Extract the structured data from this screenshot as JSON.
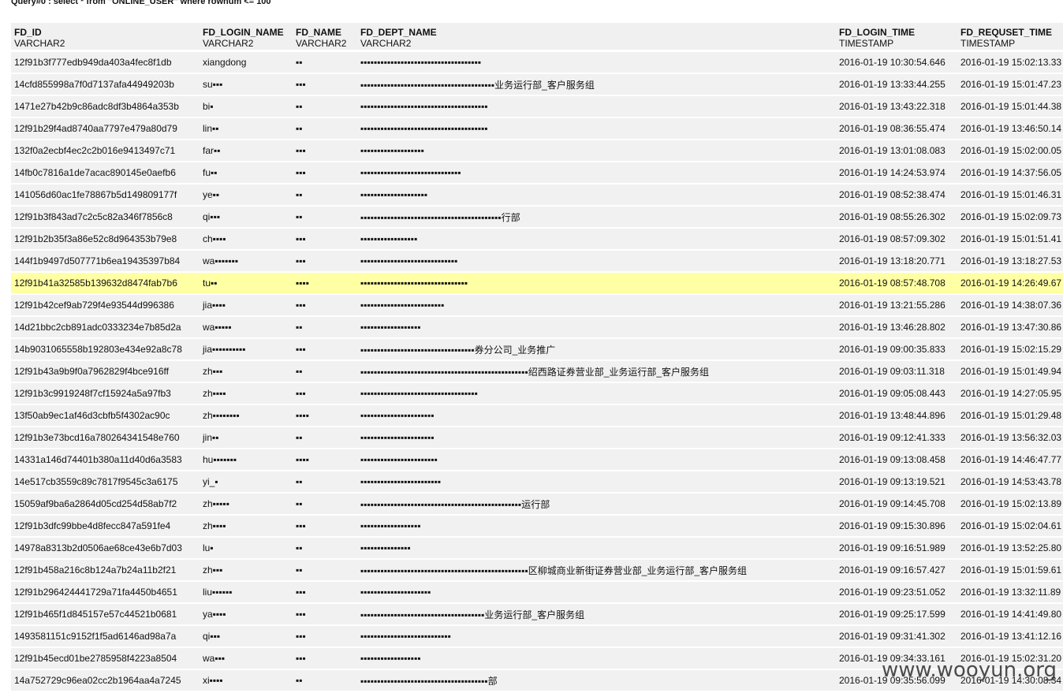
{
  "query": {
    "title": "Query#0 : select * from \"ONLINE_USER\" where rownum <= 100"
  },
  "columns": [
    {
      "name": "FD_ID",
      "type": "VARCHAR2"
    },
    {
      "name": "FD_LOGIN_NAME",
      "type": "VARCHAR2"
    },
    {
      "name": "FD_NAME",
      "type": "VARCHAR2"
    },
    {
      "name": "FD_DEPT_NAME",
      "type": "VARCHAR2"
    },
    {
      "name": "FD_LOGIN_TIME",
      "type": "TIMESTAMP"
    },
    {
      "name": "FD_REQUSET_TIME",
      "type": "TIMESTAMP"
    }
  ],
  "rows": [
    {
      "id": "12f91b3f777edb949da403a4fec8f1db",
      "login": "xiangdong",
      "name": "▪▪",
      "dept": "▪▪▪▪▪▪▪▪▪▪▪▪▪▪▪▪▪▪▪▪▪▪▪▪▪▪▪▪▪▪▪▪▪▪▪▪",
      "login_time": "2016-01-19 10:30:54.646",
      "req_time": "2016-01-19 15:02:13.33"
    },
    {
      "id": "14cfd855998a7f0d7137afa44949203b",
      "login": "su▪▪▪",
      "name": "▪▪▪",
      "dept": "▪▪▪▪▪▪▪▪▪▪▪▪▪▪▪▪▪▪▪▪▪▪▪▪▪▪▪▪▪▪▪▪▪▪▪▪▪▪▪▪业务运行部_客户服务组",
      "login_time": "2016-01-19 13:33:44.255",
      "req_time": "2016-01-19 15:01:47.23"
    },
    {
      "id": "1471e27b42b9c86adc8df3b4864a353b",
      "login": "bi▪",
      "name": "▪▪",
      "dept": "▪▪▪▪▪▪▪▪▪▪▪▪▪▪▪▪▪▪▪▪▪▪▪▪▪▪▪▪▪▪▪▪▪▪▪▪▪▪",
      "login_time": "2016-01-19 13:43:22.318",
      "req_time": "2016-01-19 15:01:44.38"
    },
    {
      "id": "12f91b29f4ad8740aa7797e479a80d79",
      "login": "lin▪▪",
      "name": "▪▪",
      "dept": "▪▪▪▪▪▪▪▪▪▪▪▪▪▪▪▪▪▪▪▪▪▪▪▪▪▪▪▪▪▪▪▪▪▪▪▪▪▪",
      "login_time": "2016-01-19 08:36:55.474",
      "req_time": "2016-01-19 13:46:50.14"
    },
    {
      "id": "132f0a2ecbf4ec2c2b016e9413497c71",
      "login": "far▪▪",
      "name": "▪▪▪",
      "dept": "▪▪▪▪▪▪▪▪▪▪▪▪▪▪▪▪▪▪▪",
      "login_time": "2016-01-19 13:01:08.083",
      "req_time": "2016-01-19 15:02:00.05"
    },
    {
      "id": "14fb0c7816a1de7acac890145e0aefb6",
      "login": "fu▪▪",
      "name": "▪▪▪",
      "dept": "▪▪▪▪▪▪▪▪▪▪▪▪▪▪▪▪▪▪▪▪▪▪▪▪▪▪▪▪▪▪",
      "login_time": "2016-01-19 14:24:53.974",
      "req_time": "2016-01-19 14:37:56.05"
    },
    {
      "id": "141056d60ac1fe78867b5d149809177f",
      "login": "ye▪▪",
      "name": "▪▪",
      "dept": "▪▪▪▪▪▪▪▪▪▪▪▪▪▪▪▪▪▪▪▪",
      "login_time": "2016-01-19 08:52:38.474",
      "req_time": "2016-01-19 15:01:46.31"
    },
    {
      "id": "12f91b3f843ad7c2c5c82a346f7856c8",
      "login": "qi▪▪▪",
      "name": "▪▪",
      "dept": "▪▪▪▪▪▪▪▪▪▪▪▪▪▪▪▪▪▪▪▪▪▪▪▪▪▪▪▪▪▪▪▪▪▪▪▪▪▪▪▪▪▪行部",
      "login_time": "2016-01-19 08:55:26.302",
      "req_time": "2016-01-19 15:02:09.73"
    },
    {
      "id": "12f91b2b35f3a86e52c8d964353b79e8",
      "login": "ch▪▪▪▪",
      "name": "▪▪▪",
      "dept": "▪▪▪▪▪▪▪▪▪▪▪▪▪▪▪▪▪",
      "login_time": "2016-01-19 08:57:09.302",
      "req_time": "2016-01-19 15:01:51.41"
    },
    {
      "id": "144f1b9497d507771b6ea19435397b84",
      "login": "wa▪▪▪▪▪▪▪",
      "name": "▪▪▪",
      "dept": "▪▪▪▪▪▪▪▪▪▪▪▪▪▪▪▪▪▪▪▪▪▪▪▪▪▪▪▪▪",
      "login_time": "2016-01-19 13:18:20.771",
      "req_time": "2016-01-19 13:18:27.53"
    },
    {
      "id": "12f91b41a32585b139632d8474fab7b6",
      "login": "tu▪▪",
      "name": "▪▪▪▪",
      "dept": "▪▪▪▪▪▪▪▪▪▪▪▪▪▪▪▪▪▪▪▪▪▪▪▪▪▪▪▪▪▪▪▪",
      "login_time": "2016-01-19 08:57:48.708",
      "req_time": "2016-01-19 14:26:49.67",
      "highlight": true
    },
    {
      "id": "12f91b42cef9ab729f4e93544d996386",
      "login": "jia▪▪▪▪",
      "name": "▪▪▪",
      "dept": "▪▪▪▪▪▪▪▪▪▪▪▪▪▪▪▪▪▪▪▪▪▪▪▪▪",
      "login_time": "2016-01-19 13:21:55.286",
      "req_time": "2016-01-19 14:38:07.36"
    },
    {
      "id": "14d21bbc2cb891adc0333234e7b85d2a",
      "login": "wa▪▪▪▪▪",
      "name": "▪▪",
      "dept": "▪▪▪▪▪▪▪▪▪▪▪▪▪▪▪▪▪▪",
      "login_time": "2016-01-19 13:46:28.802",
      "req_time": "2016-01-19 13:47:30.86"
    },
    {
      "id": "14b9031065558b192803e434e92a8c78",
      "login": "jia▪▪▪▪▪▪▪▪▪▪",
      "name": "▪▪▪",
      "dept": "▪▪▪▪▪▪▪▪▪▪▪▪▪▪▪▪▪▪▪▪▪▪▪▪▪▪▪▪▪▪▪▪▪▪券分公司_业务推广",
      "login_time": "2016-01-19 09:00:35.833",
      "req_time": "2016-01-19 15:02:15.29"
    },
    {
      "id": "12f91b43a9b9f0a7962829f4bce916ff",
      "login": "zh▪▪▪",
      "name": "▪▪",
      "dept": "▪▪▪▪▪▪▪▪▪▪▪▪▪▪▪▪▪▪▪▪▪▪▪▪▪▪▪▪▪▪▪▪▪▪▪▪▪▪▪▪▪▪▪▪▪▪▪▪▪▪绍西路证券营业部_业务运行部_客户服务组",
      "login_time": "2016-01-19 09:03:11.318",
      "req_time": "2016-01-19 15:01:49.94"
    },
    {
      "id": "12f91b3c9919248f7cf15924a5a97fb3",
      "login": "zh▪▪▪▪",
      "name": "▪▪▪",
      "dept": "▪▪▪▪▪▪▪▪▪▪▪▪▪▪▪▪▪▪▪▪▪▪▪▪▪▪▪▪▪▪▪▪▪▪▪",
      "login_time": "2016-01-19 09:05:08.443",
      "req_time": "2016-01-19 14:27:05.95"
    },
    {
      "id": "13f50ab9ec1af46d3cbfb5f4302ac90c",
      "login": "zh▪▪▪▪▪▪▪▪",
      "name": "▪▪▪▪",
      "dept": "▪▪▪▪▪▪▪▪▪▪▪▪▪▪▪▪▪▪▪▪▪▪",
      "login_time": "2016-01-19 13:48:44.896",
      "req_time": "2016-01-19 15:01:29.48"
    },
    {
      "id": "12f91b3e73bcd16a780264341548e760",
      "login": "jin▪▪",
      "name": "▪▪",
      "dept": "▪▪▪▪▪▪▪▪▪▪▪▪▪▪▪▪▪▪▪▪▪▪",
      "login_time": "2016-01-19 09:12:41.333",
      "req_time": "2016-01-19 13:56:32.03"
    },
    {
      "id": "14331a146d74401b380a11d40d6a3583",
      "login": "hu▪▪▪▪▪▪▪",
      "name": "▪▪▪▪",
      "dept": "▪▪▪▪▪▪▪▪▪▪▪▪▪▪▪▪▪▪▪▪▪▪▪",
      "login_time": "2016-01-19 09:13:08.458",
      "req_time": "2016-01-19 14:46:47.77"
    },
    {
      "id": "14e517cb3559c89c7817f9545c3a6175",
      "login": "yi_▪",
      "name": "▪▪",
      "dept": "▪▪▪▪▪▪▪▪▪▪▪▪▪▪▪▪▪▪▪▪▪▪▪▪",
      "login_time": "2016-01-19 09:13:19.521",
      "req_time": "2016-01-19 14:53:43.78"
    },
    {
      "id": "15059af9ba6a2864d05cd254d58ab7f2",
      "login": "zh▪▪▪▪▪",
      "name": "▪▪",
      "dept": "▪▪▪▪▪▪▪▪▪▪▪▪▪▪▪▪▪▪▪▪▪▪▪▪▪▪▪▪▪▪▪▪▪▪▪▪▪▪▪▪▪▪▪▪▪▪▪▪运行部",
      "login_time": "2016-01-19 09:14:45.708",
      "req_time": "2016-01-19 15:02:13.89"
    },
    {
      "id": "12f91b3dfc99bbe4d8fecc847a591fe4",
      "login": "zh▪▪▪▪",
      "name": "▪▪▪",
      "dept": "▪▪▪▪▪▪▪▪▪▪▪▪▪▪▪▪▪▪",
      "login_time": "2016-01-19 09:15:30.896",
      "req_time": "2016-01-19 15:02:04.61"
    },
    {
      "id": "14978a8313b2d0506ae68ce43e6b7d03",
      "login": "lu▪",
      "name": "▪▪",
      "dept": "▪▪▪▪▪▪▪▪▪▪▪▪▪▪▪",
      "login_time": "2016-01-19 09:16:51.989",
      "req_time": "2016-01-19 13:52:25.80"
    },
    {
      "id": "12f91b458a216c8b124a7b24a11b2f21",
      "login": "zh▪▪▪",
      "name": "▪▪",
      "dept": "▪▪▪▪▪▪▪▪▪▪▪▪▪▪▪▪▪▪▪▪▪▪▪▪▪▪▪▪▪▪▪▪▪▪▪▪▪▪▪▪▪▪▪▪▪▪▪▪▪▪区柳城商业新街证券营业部_业务运行部_客户服务组",
      "login_time": "2016-01-19 09:16:57.427",
      "req_time": "2016-01-19 15:01:59.61"
    },
    {
      "id": "12f91b296424441729a71fa4450b4651",
      "login": "liu▪▪▪▪▪▪",
      "name": "▪▪▪",
      "dept": "▪▪▪▪▪▪▪▪▪▪▪▪▪▪▪▪▪▪▪▪▪",
      "login_time": "2016-01-19 09:23:51.052",
      "req_time": "2016-01-19 13:32:11.89"
    },
    {
      "id": "12f91b465f1d845157e57c44521b0681",
      "login": "ya▪▪▪▪",
      "name": "▪▪▪",
      "dept": "▪▪▪▪▪▪▪▪▪▪▪▪▪▪▪▪▪▪▪▪▪▪▪▪▪▪▪▪▪▪▪▪▪▪▪▪▪业务运行部_客户服务组",
      "login_time": "2016-01-19 09:25:17.599",
      "req_time": "2016-01-19 14:41:49.80"
    },
    {
      "id": "1493581151c9152f1f5ad6146ad98a7a",
      "login": "qi▪▪▪",
      "name": "▪▪▪",
      "dept": "▪▪▪▪▪▪▪▪▪▪▪▪▪▪▪▪▪▪▪▪▪▪▪▪▪▪▪",
      "login_time": "2016-01-19 09:31:41.302",
      "req_time": "2016-01-19 13:41:12.16"
    },
    {
      "id": "12f91b45ecd01be2785958f4223a8504",
      "login": "wa▪▪▪",
      "name": "▪▪▪",
      "dept": "▪▪▪▪▪▪▪▪▪▪▪▪▪▪▪▪▪▪",
      "login_time": "2016-01-19 09:34:33.161",
      "req_time": "2016-01-19 15:02:31.20"
    },
    {
      "id": "14a752729c96ea02cc2b1964aa4a7245",
      "login": "xi▪▪▪▪",
      "name": "▪▪",
      "dept": "▪▪▪▪▪▪▪▪▪▪▪▪▪▪▪▪▪▪▪▪▪▪▪▪▪▪▪▪▪▪▪▪▪▪▪▪▪▪部",
      "login_time": "2016-01-19 09:35:56.099",
      "req_time": "2016-01-19 14:30:08.34"
    }
  ],
  "watermark": "www.wooyun.org"
}
